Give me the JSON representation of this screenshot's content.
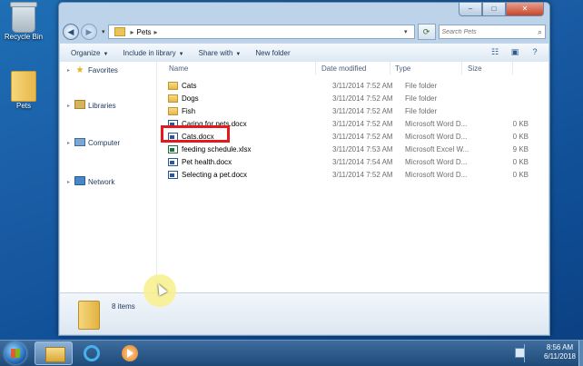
{
  "desktop": {
    "icons": [
      {
        "label": "Recycle Bin",
        "icon": "recycle-bin-icon"
      },
      {
        "label": "Pets",
        "icon": "folder-icon"
      }
    ]
  },
  "window": {
    "caption": {
      "minimize": "–",
      "maximize": "□",
      "close": "✕"
    },
    "address": {
      "path_root_icon": "folder-icon",
      "crumb": "Pets"
    },
    "search": {
      "placeholder": "Search Pets"
    },
    "toolbar": {
      "organize": "Organize",
      "include_in_library": "Include in library",
      "share_with": "Share with",
      "new_folder": "New folder"
    },
    "nav_pane": [
      {
        "label": "Favorites",
        "icon": "star-icon"
      },
      {
        "label": "Libraries",
        "icon": "libraries-icon"
      },
      {
        "label": "Computer",
        "icon": "computer-icon"
      },
      {
        "label": "Network",
        "icon": "network-icon"
      }
    ],
    "columns": {
      "name": "Name",
      "date_modified": "Date modified",
      "type": "Type",
      "size": "Size"
    },
    "files": [
      {
        "name": "Cats",
        "date": "3/11/2014 7:52 AM",
        "type": "File folder",
        "size": "",
        "icon": "folder"
      },
      {
        "name": "Dogs",
        "date": "3/11/2014 7:52 AM",
        "type": "File folder",
        "size": "",
        "icon": "folder"
      },
      {
        "name": "Fish",
        "date": "3/11/2014 7:52 AM",
        "type": "File folder",
        "size": "",
        "icon": "folder"
      },
      {
        "name": "Caring for pets.docx",
        "date": "3/11/2014 7:52 AM",
        "type": "Microsoft Word D...",
        "size": "0 KB",
        "icon": "word"
      },
      {
        "name": "Cats.docx",
        "date": "3/11/2014 7:52 AM",
        "type": "Microsoft Word D...",
        "size": "0 KB",
        "icon": "word"
      },
      {
        "name": "feeding schedule.xlsx",
        "date": "3/11/2014 7:53 AM",
        "type": "Microsoft Excel W...",
        "size": "9 KB",
        "icon": "excel"
      },
      {
        "name": "Pet health.docx",
        "date": "3/11/2014 7:54 AM",
        "type": "Microsoft Word D...",
        "size": "0 KB",
        "icon": "word"
      },
      {
        "name": "Selecting a pet.docx",
        "date": "3/11/2014 7:52 AM",
        "type": "Microsoft Word D...",
        "size": "0 KB",
        "icon": "word"
      }
    ],
    "details": {
      "item_count": "8 items"
    }
  },
  "taskbar": {
    "time": "8:56 AM",
    "date": "6/11/2018",
    "buttons": [
      "windows-explorer",
      "internet-explorer",
      "media-player"
    ]
  },
  "colors": {
    "highlight_box": "#e3191e",
    "accent": "#1e6fb5"
  }
}
